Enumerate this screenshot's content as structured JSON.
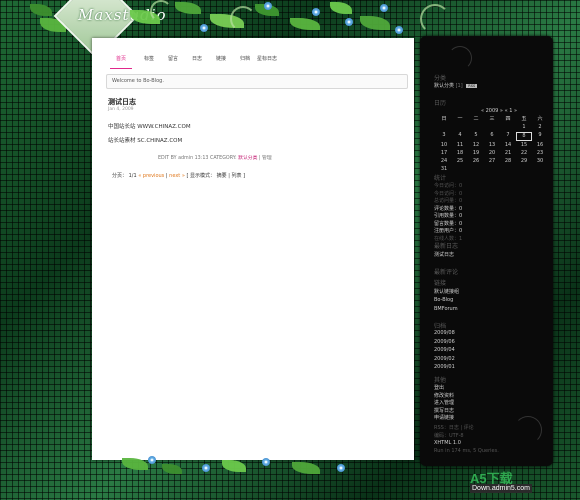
{
  "logo": {
    "text": "Maxstudio"
  },
  "nav": {
    "items": [
      {
        "label": "首页"
      },
      {
        "label": "标签"
      },
      {
        "label": "留言"
      },
      {
        "label": "日志"
      },
      {
        "label": "链接"
      },
      {
        "label": "归档"
      },
      {
        "label": "星标日志"
      }
    ]
  },
  "welcome": "Welcome to Bo-Blog.",
  "post": {
    "title": "测试日志",
    "date": "Jan 4, 2009",
    "line1": "中国站长站 WWW.CHINAZ.COM",
    "line2": "站长站素材 SC.CHINAZ.COM",
    "meta_prefix": "EDIT BY admin 13:13  CATEGORY:",
    "meta_category": "默认分类",
    "meta_suffix": "| 管理"
  },
  "pager": {
    "label": "分页：",
    "page": "1/1",
    "prev": "« previous",
    "sep": "|",
    "next": "next »",
    "view_mode": "[ 显示模式：",
    "mode_summary": "摘要",
    "mode_list": "| 列表 ]"
  },
  "sidebar": {
    "category_heading": "分类",
    "category_item": "默认分类",
    "category_count": "[1]",
    "category_badge": "RSS",
    "date_heading": "日历",
    "calendar_header": "« 2009 »    « 1 »",
    "weekdays": [
      "日",
      "一",
      "二",
      "三",
      "四",
      "五",
      "六"
    ],
    "days": [
      "",
      "",
      "",
      "",
      "",
      "1",
      "2",
      "3",
      "4",
      "5",
      "6",
      "7",
      "8",
      "9",
      "10",
      "11",
      "12",
      "13",
      "14",
      "15",
      "16",
      "17",
      "18",
      "19",
      "20",
      "21",
      "22",
      "23",
      "24",
      "25",
      "26",
      "27",
      "28",
      "29",
      "30",
      "31",
      "",
      "",
      "",
      "",
      "",
      ""
    ],
    "today": "8",
    "stats_heading": "统计",
    "stats": [
      {
        "text": "今日访问：0",
        "dim": true
      },
      {
        "text": "今日访问：0",
        "dim": true
      },
      {
        "text": "总访问量：0",
        "dim": true
      },
      {
        "text": "评论数量：0",
        "dim": false
      },
      {
        "text": "引用数量：0",
        "dim": false
      },
      {
        "text": "留言数量：0",
        "dim": false
      },
      {
        "text": "注册用户：0",
        "dim": false
      },
      {
        "text": "在线人数：1",
        "dim": true
      }
    ],
    "recent_heading": "最新日志",
    "recent_item": "测试日志",
    "comments_heading": "最新评论",
    "links_heading": "链接",
    "links": [
      "默认链接组",
      "Bo-Blog",
      "BMForum"
    ],
    "archive_heading": "归档",
    "archives": [
      "2009/08",
      "2009/06",
      "2009/04",
      "2009/02",
      "2009/01"
    ],
    "other_heading": "其他",
    "other": [
      "登出",
      "修改资料",
      "进入管理",
      "撰写日志",
      "申请链接"
    ],
    "rss_line": "RSS：日志 | 评论",
    "encoding": "编码：UTF-8",
    "xhtml": "XHTML 1.0",
    "runtime": "Run in 174 ms, 5 Queries."
  },
  "watermark": {
    "main": "A5下载",
    "sub": "Down.admin5.com"
  }
}
